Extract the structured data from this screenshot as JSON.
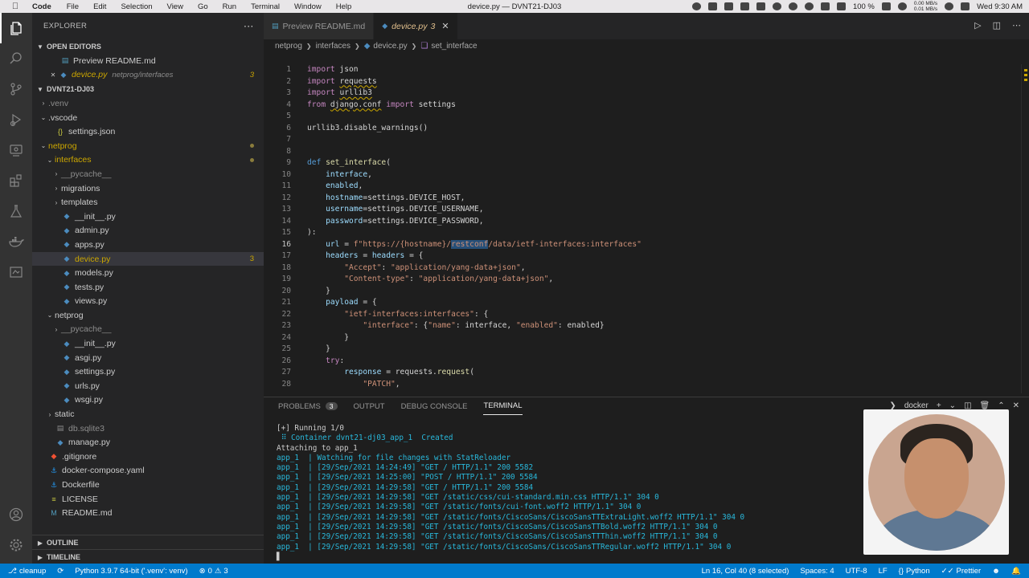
{
  "menubar": {
    "app": "Code",
    "items": [
      "File",
      "Edit",
      "Selection",
      "View",
      "Go",
      "Run",
      "Terminal",
      "Window",
      "Help"
    ],
    "window_title": "device.py — DVNT21-DJ03",
    "battery": "100 %",
    "net_up": "0.00 MB/s",
    "net_down": "0.01 MB/s",
    "clock": "Wed 9:30 AM"
  },
  "activity": [
    "files-icon",
    "search-icon",
    "source-control-icon",
    "run-debug-icon",
    "remote-explorer-icon",
    "extensions-icon",
    "testing-icon",
    "docker-icon",
    "screencast-icon"
  ],
  "sidebar": {
    "title": "EXPLORER",
    "open_editors_label": "OPEN EDITORS",
    "open_editors": [
      {
        "name": "Preview README.md",
        "desc": "",
        "badge": ""
      },
      {
        "name": "device.py",
        "desc": "netprog/interfaces",
        "badge": "3"
      }
    ],
    "workspace_label": "DVNT21-DJ03",
    "tree": [
      {
        "name": ".venv",
        "depth": 1,
        "type": "folder",
        "open": false,
        "style": "dim"
      },
      {
        "name": ".vscode",
        "depth": 1,
        "type": "folder",
        "open": true
      },
      {
        "name": "settings.json",
        "depth": 2,
        "type": "json"
      },
      {
        "name": "netprog",
        "depth": 1,
        "type": "folder",
        "open": true,
        "style": "warn",
        "dot": true
      },
      {
        "name": "interfaces",
        "depth": 2,
        "type": "folder",
        "open": true,
        "style": "warn",
        "dot": true
      },
      {
        "name": "__pycache__",
        "depth": 3,
        "type": "folder",
        "open": false,
        "style": "dim"
      },
      {
        "name": "migrations",
        "depth": 3,
        "type": "folder",
        "open": false
      },
      {
        "name": "templates",
        "depth": 3,
        "type": "folder",
        "open": false
      },
      {
        "name": "__init__.py",
        "depth": 3,
        "type": "py"
      },
      {
        "name": "admin.py",
        "depth": 3,
        "type": "py"
      },
      {
        "name": "apps.py",
        "depth": 3,
        "type": "py"
      },
      {
        "name": "device.py",
        "depth": 3,
        "type": "py",
        "style": "warn",
        "selected": true,
        "badge": "3"
      },
      {
        "name": "models.py",
        "depth": 3,
        "type": "py"
      },
      {
        "name": "tests.py",
        "depth": 3,
        "type": "py"
      },
      {
        "name": "views.py",
        "depth": 3,
        "type": "py"
      },
      {
        "name": "netprog",
        "depth": 2,
        "type": "folder",
        "open": true
      },
      {
        "name": "__pycache__",
        "depth": 3,
        "type": "folder",
        "open": false,
        "style": "dim"
      },
      {
        "name": "__init__.py",
        "depth": 3,
        "type": "py"
      },
      {
        "name": "asgi.py",
        "depth": 3,
        "type": "py"
      },
      {
        "name": "settings.py",
        "depth": 3,
        "type": "py"
      },
      {
        "name": "urls.py",
        "depth": 3,
        "type": "py"
      },
      {
        "name": "wsgi.py",
        "depth": 3,
        "type": "py"
      },
      {
        "name": "static",
        "depth": 2,
        "type": "folder",
        "open": false
      },
      {
        "name": "db.sqlite3",
        "depth": 2,
        "type": "db",
        "style": "dim"
      },
      {
        "name": "manage.py",
        "depth": 2,
        "type": "py"
      },
      {
        "name": ".gitignore",
        "depth": 1,
        "type": "git"
      },
      {
        "name": "docker-compose.yaml",
        "depth": 1,
        "type": "docker"
      },
      {
        "name": "Dockerfile",
        "depth": 1,
        "type": "docker"
      },
      {
        "name": "LICENSE",
        "depth": 1,
        "type": "license"
      },
      {
        "name": "README.md",
        "depth": 1,
        "type": "md"
      }
    ],
    "outline_label": "OUTLINE",
    "timeline_label": "TIMELINE"
  },
  "tabs": [
    {
      "label": "Preview README.md",
      "active": false,
      "badge": ""
    },
    {
      "label": "device.py",
      "active": true,
      "badge": "3"
    }
  ],
  "breadcrumb": [
    "netprog",
    "interfaces",
    "device.py",
    "set_interface"
  ],
  "editor": {
    "current_line": 16,
    "lines": [
      [
        {
          "t": "import",
          "c": "kw"
        },
        {
          "t": " json"
        }
      ],
      [
        {
          "t": "import",
          "c": "kw"
        },
        {
          "t": " "
        },
        {
          "t": "requests",
          "c": "sq"
        }
      ],
      [
        {
          "t": "import",
          "c": "kw"
        },
        {
          "t": " "
        },
        {
          "t": "urllib3",
          "c": "sq"
        }
      ],
      [
        {
          "t": "from",
          "c": "kw"
        },
        {
          "t": " "
        },
        {
          "t": "django.conf",
          "c": "sq"
        },
        {
          "t": " "
        },
        {
          "t": "import",
          "c": "kw"
        },
        {
          "t": " settings"
        }
      ],
      [],
      [
        {
          "t": "urllib3.disable_warnings()"
        }
      ],
      [],
      [],
      [
        {
          "t": "def",
          "c": "kw2"
        },
        {
          "t": " "
        },
        {
          "t": "set_interface",
          "c": "fn"
        },
        {
          "t": "("
        }
      ],
      [
        {
          "t": "    "
        },
        {
          "t": "interface",
          "c": "prm"
        },
        {
          "t": ","
        }
      ],
      [
        {
          "t": "    "
        },
        {
          "t": "enabled",
          "c": "prm"
        },
        {
          "t": ","
        }
      ],
      [
        {
          "t": "    "
        },
        {
          "t": "hostname",
          "c": "prm"
        },
        {
          "t": "=settings.DEVICE_HOST,"
        }
      ],
      [
        {
          "t": "    "
        },
        {
          "t": "username",
          "c": "prm"
        },
        {
          "t": "=settings.DEVICE_USERNAME,"
        }
      ],
      [
        {
          "t": "    "
        },
        {
          "t": "password",
          "c": "prm"
        },
        {
          "t": "=settings.DEVICE_PASSWORD,"
        }
      ],
      [
        {
          "t": "):"
        }
      ],
      [
        {
          "t": "    "
        },
        {
          "t": "url",
          "c": "var"
        },
        {
          "t": " = "
        },
        {
          "t": "f\"https://{hostname}/",
          "c": "str"
        },
        {
          "t": "restconf",
          "c": "str sel"
        },
        {
          "t": "/data/ietf-interfaces:interfaces\"",
          "c": "str"
        }
      ],
      [
        {
          "t": "    "
        },
        {
          "t": "headers",
          "c": "var"
        },
        {
          "t": " = "
        },
        {
          "t": "headers",
          "c": "var"
        },
        {
          "t": " = {"
        }
      ],
      [
        {
          "t": "        "
        },
        {
          "t": "\"Accept\"",
          "c": "str"
        },
        {
          "t": ": "
        },
        {
          "t": "\"application/yang-data+json\"",
          "c": "str"
        },
        {
          "t": ","
        }
      ],
      [
        {
          "t": "        "
        },
        {
          "t": "\"Content-type\"",
          "c": "str"
        },
        {
          "t": ": "
        },
        {
          "t": "\"application/yang-data+json\"",
          "c": "str"
        },
        {
          "t": ","
        }
      ],
      [
        {
          "t": "    }"
        }
      ],
      [
        {
          "t": "    "
        },
        {
          "t": "payload",
          "c": "var"
        },
        {
          "t": " = {"
        }
      ],
      [
        {
          "t": "        "
        },
        {
          "t": "\"ietf-interfaces:interfaces\"",
          "c": "str"
        },
        {
          "t": ": {"
        }
      ],
      [
        {
          "t": "            "
        },
        {
          "t": "\"interface\"",
          "c": "str"
        },
        {
          "t": ": {"
        },
        {
          "t": "\"name\"",
          "c": "str"
        },
        {
          "t": ": interface, "
        },
        {
          "t": "\"enabled\"",
          "c": "str"
        },
        {
          "t": ": enabled}"
        }
      ],
      [
        {
          "t": "        }"
        }
      ],
      [
        {
          "t": "    }"
        }
      ],
      [
        {
          "t": "    "
        },
        {
          "t": "try",
          "c": "kw"
        },
        {
          "t": ":"
        }
      ],
      [
        {
          "t": "        "
        },
        {
          "t": "response",
          "c": "var"
        },
        {
          "t": " = requests."
        },
        {
          "t": "request",
          "c": "fn"
        },
        {
          "t": "("
        }
      ],
      [
        {
          "t": "            "
        },
        {
          "t": "\"PATCH\"",
          "c": "str"
        },
        {
          "t": ","
        }
      ]
    ]
  },
  "panel": {
    "tabs": [
      {
        "label": "PROBLEMS",
        "badge": "3",
        "active": false
      },
      {
        "label": "OUTPUT",
        "badge": "",
        "active": false
      },
      {
        "label": "DEBUG CONSOLE",
        "badge": "",
        "active": false
      },
      {
        "label": "TERMINAL",
        "badge": "",
        "active": true
      }
    ],
    "terminal_name": "docker",
    "terminal": [
      "[+] Running 1/0",
      " ⠿ Container dvnt21-dj03_app_1  Created",
      "Attaching to app_1",
      "app_1  | Watching for file changes with StatReloader",
      "app_1  | [29/Sep/2021 14:24:49] \"GET / HTTP/1.1\" 200 5582",
      "app_1  | [29/Sep/2021 14:25:00] \"POST / HTTP/1.1\" 200 5584",
      "app_1  | [29/Sep/2021 14:29:58] \"GET / HTTP/1.1\" 200 5584",
      "app_1  | [29/Sep/2021 14:29:58] \"GET /static/css/cui-standard.min.css HTTP/1.1\" 304 0",
      "app_1  | [29/Sep/2021 14:29:58] \"GET /static/fonts/cui-font.woff2 HTTP/1.1\" 304 0",
      "app_1  | [29/Sep/2021 14:29:58] \"GET /static/fonts/CiscoSans/CiscoSansTTExtraLight.woff2 HTTP/1.1\" 304 0",
      "app_1  | [29/Sep/2021 14:29:58] \"GET /static/fonts/CiscoSans/CiscoSansTTBold.woff2 HTTP/1.1\" 304 0",
      "app_1  | [29/Sep/2021 14:29:58] \"GET /static/fonts/CiscoSans/CiscoSansTTThin.woff2 HTTP/1.1\" 304 0",
      "app_1  | [29/Sep/2021 14:29:58] \"GET /static/fonts/CiscoSans/CiscoSansTTRegular.woff2 HTTP/1.1\" 304 0",
      "▋"
    ]
  },
  "statusbar": {
    "branch": "cleanup",
    "python": "Python 3.9.7 64-bit ('.venv': venv)",
    "errors": "0",
    "warnings": "3",
    "position": "Ln 16, Col 40 (8 selected)",
    "spaces": "Spaces: 4",
    "encoding": "UTF-8",
    "eol": "LF",
    "language": "Python",
    "prettier": "Prettier"
  }
}
